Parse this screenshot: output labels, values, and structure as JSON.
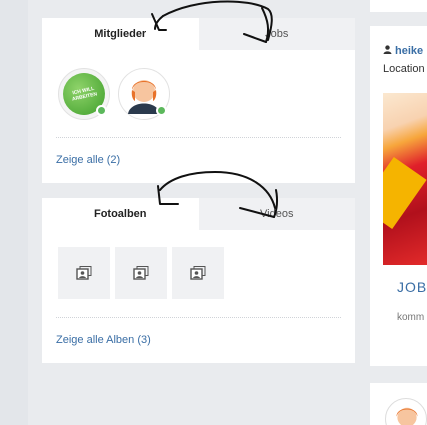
{
  "members_widget": {
    "tabs": [
      {
        "label": "Mitglieder",
        "active": true
      },
      {
        "label": "Jobs",
        "active": false
      }
    ],
    "members": [
      {
        "type": "badge",
        "badge_text": "ICH WILL ARBEITEN",
        "online": true
      },
      {
        "type": "cartoon-avatar",
        "online": true
      }
    ],
    "show_all_label": "Zeige alle (2)"
  },
  "albums_widget": {
    "tabs": [
      {
        "label": "Fotoalben",
        "active": true
      },
      {
        "label": "Videos",
        "active": false
      }
    ],
    "album_count_visible": 3,
    "show_all_label": "Zeige alle Alben (3)"
  },
  "right_column": {
    "profile_name": "heike",
    "location_label": "Location",
    "job_title": "JOB",
    "snippet": "komm"
  },
  "colors": {
    "link": "#3a6ea5",
    "online": "#5cb85c",
    "background": "#e9ebee"
  }
}
